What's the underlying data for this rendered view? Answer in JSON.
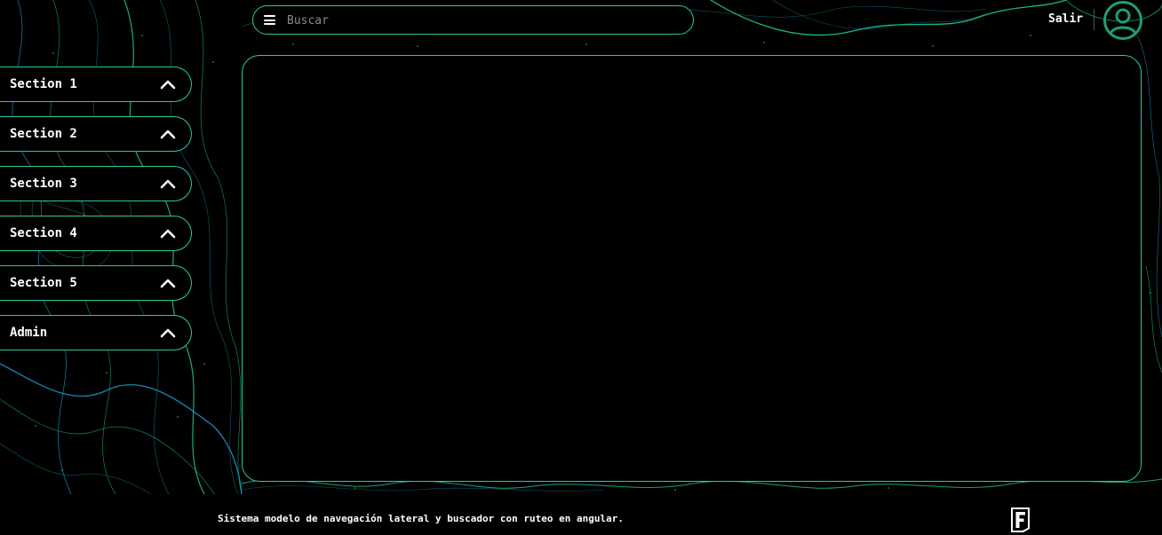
{
  "header": {
    "search": {
      "placeholder": "Buscar",
      "value": ""
    },
    "menu_icon": "hamburger-menu-icon",
    "logout_label": "Salir",
    "avatar_icon": "user-circle-icon"
  },
  "sidebar": {
    "items": [
      {
        "label": "Section 1",
        "icon": "chevron-up-icon"
      },
      {
        "label": "Section 2",
        "icon": "chevron-up-icon"
      },
      {
        "label": "Section 3",
        "icon": "chevron-up-icon"
      },
      {
        "label": "Section 4",
        "icon": "chevron-up-icon"
      },
      {
        "label": "Section 5",
        "icon": "chevron-up-icon"
      },
      {
        "label": "Admin",
        "icon": "chevron-up-icon"
      }
    ]
  },
  "footer": {
    "text": "Sistema modelo de navegación lateral y buscador con ruteo en angular.",
    "logo_icon": "f-logo-icon"
  },
  "colors": {
    "accent": "#29c9a2",
    "contour_green": "#1fd6a0",
    "contour_blue": "#1aa8d8",
    "background": "#000000",
    "avatar": "#1f9e78"
  }
}
